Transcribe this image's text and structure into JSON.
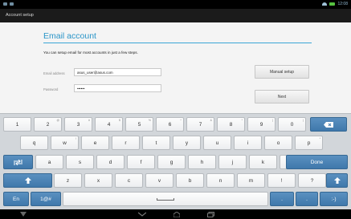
{
  "status_bar": {
    "time": "12:08",
    "left_icons": [
      "notification-icon",
      "notification-icon"
    ],
    "right_icons": [
      "wifi-icon",
      "battery-icon"
    ]
  },
  "action_bar": {
    "title": "Account setup"
  },
  "form": {
    "title": "Email account",
    "intro": "You can setup email for most accounts in just a few steps.",
    "email_label": "Email address",
    "email_value": "asus_user@asus.com",
    "password_label": "Password",
    "password_value": "••••••",
    "manual_setup_label": "Manual setup",
    "next_label": "Next"
  },
  "keyboard": {
    "row1": [
      {
        "label": "1",
        "alt": ""
      },
      {
        "label": "2",
        "alt": "@"
      },
      {
        "label": "3",
        "alt": "#"
      },
      {
        "label": "4",
        "alt": "$"
      },
      {
        "label": "5",
        "alt": "%"
      },
      {
        "label": "6",
        "alt": "^"
      },
      {
        "label": "7",
        "alt": "&"
      },
      {
        "label": "8",
        "alt": "*"
      },
      {
        "label": "9",
        "alt": "("
      },
      {
        "label": "0",
        "alt": ")"
      }
    ],
    "row2": [
      {
        "label": "q",
        "alt": ""
      },
      {
        "label": "w",
        "alt": "!"
      },
      {
        "label": "e",
        "alt": ""
      },
      {
        "label": "r",
        "alt": ""
      },
      {
        "label": "t",
        "alt": ""
      },
      {
        "label": "y",
        "alt": ""
      },
      {
        "label": "u",
        "alt": ""
      },
      {
        "label": "i",
        "alt": ""
      },
      {
        "label": "o",
        "alt": ""
      },
      {
        "label": "p",
        "alt": "*"
      }
    ],
    "row3": [
      {
        "label": "a",
        "alt": ""
      },
      {
        "label": "s",
        "alt": ""
      },
      {
        "label": "d",
        "alt": ""
      },
      {
        "label": "f",
        "alt": ""
      },
      {
        "label": "g",
        "alt": ""
      },
      {
        "label": "h",
        "alt": ""
      },
      {
        "label": "j",
        "alt": ""
      },
      {
        "label": "k",
        "alt": ""
      },
      {
        "label": "l",
        "alt": ""
      }
    ],
    "row4": [
      {
        "label": "z",
        "alt": ""
      },
      {
        "label": "x",
        "alt": ""
      },
      {
        "label": "c",
        "alt": ""
      },
      {
        "label": "v",
        "alt": ""
      },
      {
        "label": "b",
        "alt": ""
      },
      {
        "label": "n",
        "alt": ""
      },
      {
        "label": "m",
        "alt": ""
      },
      {
        "label": "!",
        "alt": ""
      },
      {
        "label": "?",
        "alt": ""
      }
    ],
    "backspace_icon": "backspace-icon",
    "tab_icon": "tab-icon",
    "shift_icon": "shift-icon",
    "done_label": "Done",
    "lang_label": "En",
    "symbols_label": "1@#",
    "period_label": ".",
    "dot2_label": ".",
    "smiley_label": ":-)"
  },
  "nav_bar": {
    "icons": [
      "back-icon",
      "home-icon",
      "recent-apps-icon",
      "keyboard-hide-icon"
    ]
  }
}
